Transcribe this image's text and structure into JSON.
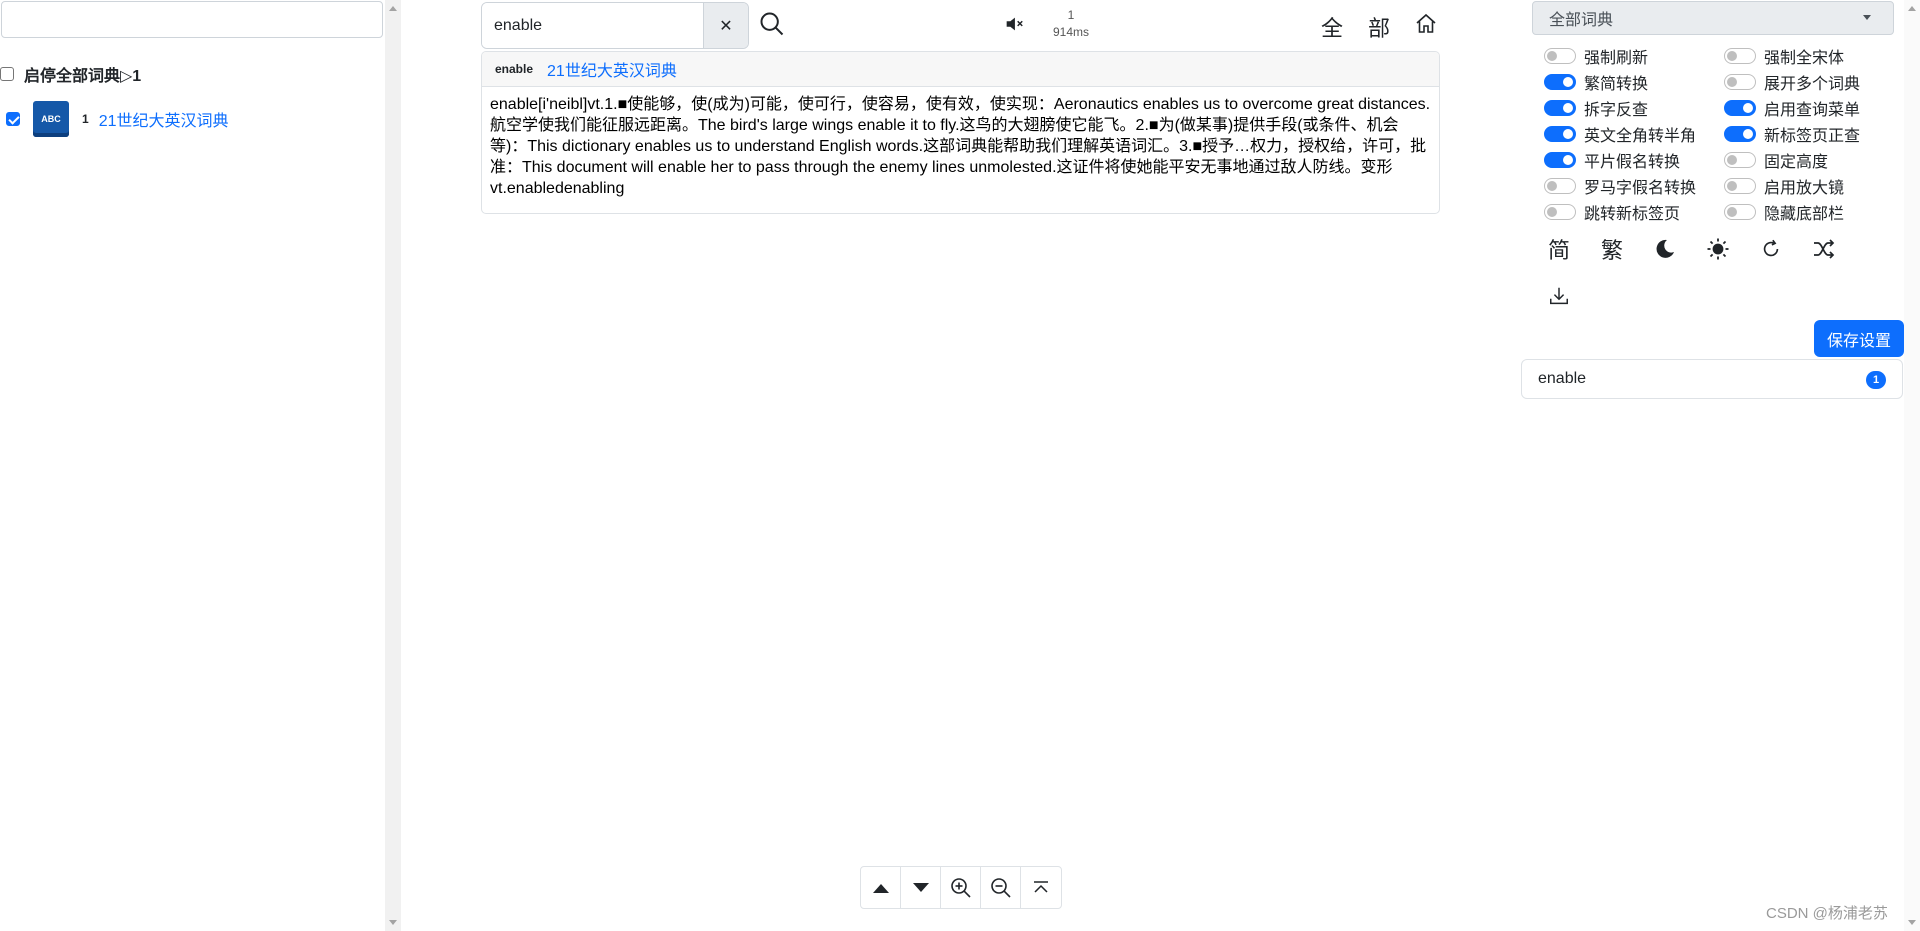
{
  "left": {
    "search_value": "",
    "toggle_all_label": "启停全部词典▷1",
    "toggle_all_checked": false,
    "dictionaries": [
      {
        "checked": true,
        "icon_text": "ABC",
        "index": "1",
        "name": "21世纪大英汉词典"
      }
    ]
  },
  "search": {
    "value": "enable",
    "clear_label": "✕",
    "timing_count": "1",
    "timing_ms": "914ms",
    "all_char": "全",
    "part_char": "部"
  },
  "result": {
    "word": "enable",
    "dict_name": "21世纪大英汉词典",
    "body": "enable[i'neibl]vt.1.■使能够，使(成为)可能，使可行，使容易，使有效，使实现：Aeronautics enables us to overcome great distances.航空学使我们能征服远距离。The bird's large wings enable it to fly.这鸟的大翅膀使它能飞。2.■为(做某事)提供手段(或条件、机会等)：This dictionary enables us to understand English words.这部词典能帮助我们理解英语词汇。3.■授予…权力，授权给，许可，批准：This document will enable her to pass through the enemy lines unmolested.这证件将使她能平安无事地通过敌人防线。变形vt.enabledenabling"
  },
  "settings": {
    "dict_select": "全部词典",
    "switches_left": [
      {
        "label": "强制刷新",
        "on": false
      },
      {
        "label": "繁简转换",
        "on": true
      },
      {
        "label": "拆字反查",
        "on": true
      },
      {
        "label": "英文全角转半角",
        "on": true
      },
      {
        "label": "平片假名转换",
        "on": true
      },
      {
        "label": "罗马字假名转换",
        "on": false
      },
      {
        "label": "跳转新标签页",
        "on": false
      }
    ],
    "switches_right": [
      {
        "label": "强制全宋体",
        "on": false
      },
      {
        "label": "展开多个词典",
        "on": false
      },
      {
        "label": "启用查询菜单",
        "on": true
      },
      {
        "label": "新标签页正查",
        "on": true
      },
      {
        "label": "固定高度",
        "on": false
      },
      {
        "label": "启用放大镜",
        "on": false
      },
      {
        "label": "隐藏底部栏",
        "on": false
      }
    ],
    "simplified_char": "简",
    "traditional_char": "繁",
    "icons": [
      "moon-icon",
      "sun-icon",
      "refresh-icon",
      "shuffle-icon",
      "download-icon"
    ],
    "save_label": "保存设置"
  },
  "history": {
    "word": "enable",
    "count": "1"
  },
  "watermark": "CSDN @杨浦老苏",
  "colors": {
    "accent": "#0d6efd",
    "dict_icon": "#1558a8"
  }
}
